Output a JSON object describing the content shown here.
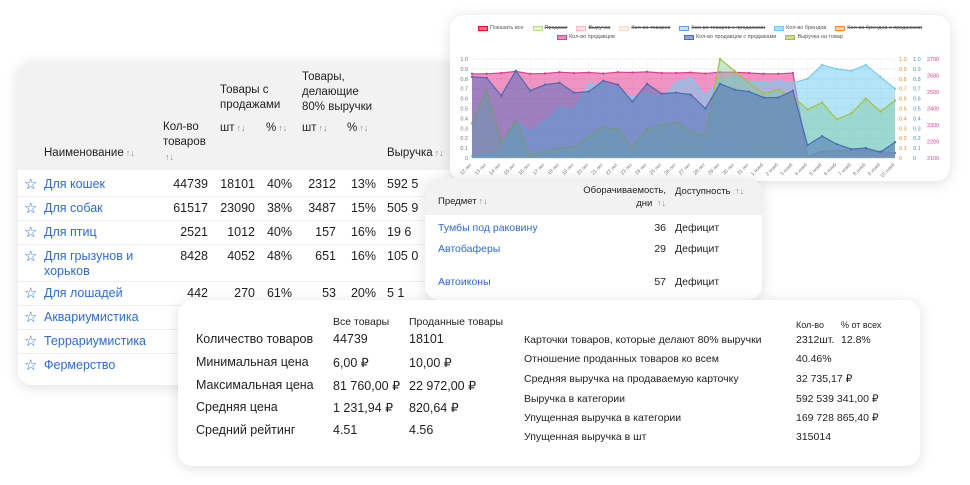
{
  "categories_table": {
    "headers": {
      "name": "Наименование",
      "count": "Кол-во товаров",
      "with_sales": "Товары с продажами",
      "top80": "Товары, делающие 80% выручки",
      "pcs": "шт",
      "pct": "%",
      "revenue": "Выручка",
      "sort_icon": "↑↓"
    },
    "rows": [
      {
        "name": "Для кошек",
        "count": "44739",
        "sales_pcs": "18101",
        "sales_pct": "40%",
        "top_pcs": "2312",
        "top_pct": "13%",
        "revenue": "592 5"
      },
      {
        "name": "Для собак",
        "count": "61517",
        "sales_pcs": "23090",
        "sales_pct": "38%",
        "top_pcs": "3487",
        "top_pct": "15%",
        "revenue": "505 9"
      },
      {
        "name": "Для птиц",
        "count": "2521",
        "sales_pcs": "1012",
        "sales_pct": "40%",
        "top_pcs": "157",
        "top_pct": "16%",
        "revenue": "19 6"
      },
      {
        "name": "Для грызунов и хорьков",
        "count": "8428",
        "sales_pcs": "4052",
        "sales_pct": "48%",
        "top_pcs": "651",
        "top_pct": "16%",
        "revenue": "105 0"
      },
      {
        "name": "Для лошадей",
        "count": "442",
        "sales_pcs": "270",
        "sales_pct": "61%",
        "top_pcs": "53",
        "top_pct": "20%",
        "revenue": "5 1"
      },
      {
        "name": "Аквариумистика"
      },
      {
        "name": "Террариумистика"
      },
      {
        "name": "Фермерство"
      }
    ]
  },
  "subjects_table": {
    "headers": {
      "subject": "Предмет",
      "turnover": "Оборачиваемость, дни",
      "availability": "Доступность"
    },
    "rows": [
      {
        "subject": "Тумбы под раковину",
        "turnover": "36",
        "availability": "Дефицит"
      },
      {
        "subject": "Автобаферы",
        "turnover": "29",
        "availability": "Дефицит"
      },
      {
        "subject": "Автоиконы",
        "turnover": "57",
        "availability": "Дефицит"
      }
    ]
  },
  "summary": {
    "col_all": "Все товары",
    "col_sold": "Проданные товары",
    "rows": [
      {
        "label": "Количество товаров",
        "all": "44739",
        "sold": "18101"
      },
      {
        "label": "Минимальная цена",
        "all": "6,00 ₽",
        "sold": "10,00 ₽"
      },
      {
        "label": "Максимальная цена",
        "all": "81 760,00 ₽",
        "sold": "22 972,00 ₽"
      },
      {
        "label": "Средняя цена",
        "all": "1 231,94 ₽",
        "sold": "820,64 ₽"
      },
      {
        "label": "Средний рейтинг",
        "all": "4.51",
        "sold": "4.56"
      }
    ],
    "col_qty": "Кол-во",
    "col_pct": "% от всех",
    "metrics": [
      {
        "label": "Карточки товаров, которые делают 80% выручки",
        "value": "2312шт.",
        "pct": "12.8%"
      },
      {
        "label": "Отношение проданных товаров ко всем",
        "value": "40.46%"
      },
      {
        "label": "Средняя выручка на продаваемую карточку",
        "value": "32 735,17 ₽"
      },
      {
        "label": "Выручка в категории",
        "value": "592 539 341,00 ₽"
      },
      {
        "label": "Упущенная выручка в категории",
        "value": "169 728 865,40 ₽"
      },
      {
        "label": "Упущенная выручка в шт",
        "value": "315014"
      }
    ]
  },
  "chart_data": {
    "type": "area",
    "legend": [
      {
        "name": "Показать все",
        "color": "#e8102a",
        "active": true
      },
      {
        "name": "Продажи",
        "color": "#b5dc8e",
        "active": false
      },
      {
        "name": "Выручка",
        "color": "#f7b8c0",
        "active": false
      },
      {
        "name": "Кол-во товаров",
        "color": "#fbd9c2",
        "active": false
      },
      {
        "name": "Кол-во товаров с продажами",
        "color": "#6f9ad8",
        "active": false
      },
      {
        "name": "Кол-во брендов",
        "color": "#74cdf0",
        "active": true
      },
      {
        "name": "Кол-во брендов с продажами",
        "color": "#f08b3c",
        "active": false
      },
      {
        "name": "Кол-во продавцов",
        "color": "#e33d93",
        "active": true
      },
      {
        "name": "Кол-во продавцов с продажами",
        "color": "#4a6bb5",
        "active": true
      },
      {
        "name": "Выручка на товар",
        "color": "#a6c13a",
        "active": true
      }
    ],
    "x": [
      "12 окт",
      "13 окт",
      "14 окт",
      "15 окт",
      "16 окт",
      "17 окт",
      "18 окт",
      "19 окт",
      "20 окт",
      "21 окт",
      "22 окт",
      "23 окт",
      "24 окт",
      "25 окт",
      "26 окт",
      "27 окт",
      "28 окт",
      "29 окт",
      "30 окт",
      "31 окт",
      "1 нояб",
      "2 нояб",
      "3 нояб",
      "4 нояб",
      "5 нояб",
      "6 нояб",
      "7 нояб",
      "8 нояб",
      "9 нояб",
      "10 нояб"
    ],
    "axes": {
      "left": {
        "ticks": [
          "0",
          "0.1",
          "0.2",
          "0.3",
          "0.4",
          "0.5",
          "0.6",
          "0.7",
          "0.8",
          "0.9",
          "1.0"
        ],
        "range": [
          0,
          1
        ]
      },
      "right_orange": {
        "ticks": [
          "0",
          "0.1",
          "0.2",
          "0.3",
          "0.4",
          "0.5",
          "0.6",
          "0.7",
          "0.8",
          "0.9",
          "1.0"
        ],
        "range": [
          0,
          1
        ],
        "color": "#e0893a"
      },
      "right_blue": {
        "ticks": [
          "0",
          "0.1",
          "0.2",
          "0.3",
          "0.4",
          "0.5",
          "0.6",
          "0.7",
          "0.8",
          "0.9",
          "1.0"
        ],
        "range": [
          0,
          1
        ],
        "color": "#4a8fd0"
      },
      "right_pink": {
        "ticks": [
          "2100",
          "2200",
          "2300",
          "2400",
          "2500",
          "2600",
          "2700"
        ],
        "range": [
          2100,
          2700
        ],
        "color": "#e33d93"
      }
    },
    "grid": true,
    "series": [
      {
        "name": "Кол-во брендов",
        "axis": "right_blue",
        "values": [
          0.02,
          0.03,
          0.05,
          0.37,
          0.27,
          0.37,
          0.51,
          0.48,
          0.75,
          0.75,
          0.7,
          0.61,
          0.66,
          0.6,
          0.76,
          0.81,
          0.63,
          0.79,
          0.82,
          0.77,
          0.76,
          0.78,
          0.76,
          0.8,
          0.94,
          0.9,
          0.88,
          0.94,
          0.82,
          0.7
        ]
      },
      {
        "name": "Выручка на товар",
        "axis": "right_orange",
        "values": [
          0.35,
          0.69,
          0.16,
          0.37,
          0.02,
          0.07,
          0.1,
          0.11,
          0.21,
          0.31,
          0.29,
          0.11,
          0.29,
          0.33,
          0.36,
          0.27,
          0.22,
          1.0,
          0.88,
          0.76,
          0.65,
          0.69,
          0.62,
          0.49,
          0.56,
          0.39,
          0.45,
          0.6,
          0.47,
          0.58
        ]
      },
      {
        "name": "Кол-во продавцов",
        "axis": "right_pink",
        "values": [
          2610,
          2610,
          2615,
          2625,
          2610,
          2612,
          2620,
          2615,
          2618,
          2612,
          2620,
          2618,
          2622,
          2615,
          2615,
          2618,
          2612,
          2620,
          2620,
          2615,
          2610,
          2610,
          2615,
          2110,
          2140,
          2145,
          2150,
          2145,
          2140,
          2130
        ]
      },
      {
        "name": "Кол-во продавцов с продажами",
        "axis": "left",
        "values": [
          0.82,
          0.81,
          0.63,
          0.88,
          0.68,
          0.74,
          0.76,
          0.66,
          0.67,
          0.78,
          0.74,
          0.57,
          0.75,
          0.65,
          0.66,
          0.64,
          0.5,
          0.75,
          0.69,
          0.67,
          0.61,
          0.61,
          0.68,
          0.13,
          0.22,
          0.14,
          0.09,
          0.1,
          0.06,
          0.16
        ]
      }
    ]
  }
}
